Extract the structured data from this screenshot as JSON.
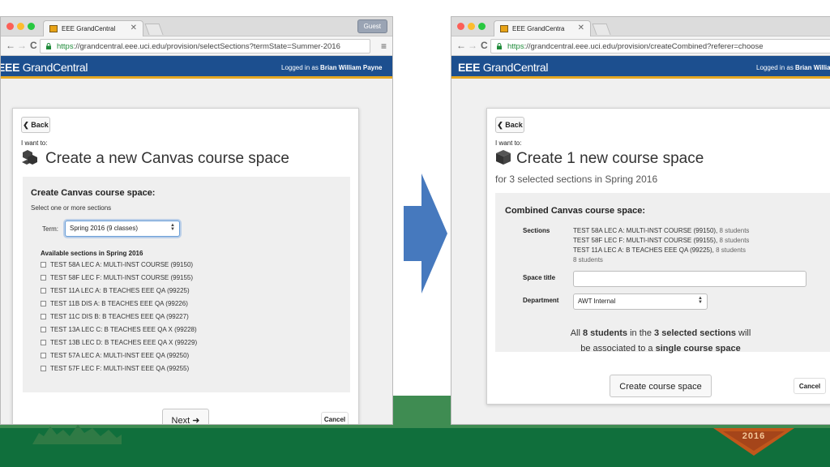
{
  "colors": {
    "app_bar": "#1c4f8f",
    "accent_stripe": "#e5a823",
    "green_light": "#3f8c52",
    "green_dark": "#106f3c",
    "arrow": "#4679be"
  },
  "background": {
    "banner_year": "2016"
  },
  "left": {
    "tab_title": "EEE GrandCentral",
    "tab_close": "✕",
    "guest_label": "Guest",
    "nav": {
      "back": "←",
      "forward": "→",
      "reload": "C"
    },
    "url_scheme": "https",
    "url_rest": "://grandcentral.eee.uci.edu/provision/selectSections?termState=Summer-2016",
    "menu_icon": "≡",
    "brand_bold": "EEE ",
    "brand_light": "GrandCentral",
    "login_prefix": "Logged in as ",
    "login_name": "Brian William Payne",
    "back_chevron": "❮",
    "back_label": "Back",
    "i_want_to": "I want to:",
    "heading": "Create a new Canvas course space",
    "panel_title": "Create Canvas course space:",
    "instruction": "Select one or more sections",
    "term_label": "Term:",
    "term_value": "Spring 2016 (9 classes)",
    "caret_up": "▲",
    "caret_down": "▼",
    "available_label": "Available sections in Spring 2016",
    "sections": [
      "TEST 58A LEC A: MULTI-INST COURSE (99150)",
      "TEST 58F LEC F: MULTI-INST COURSE (99155)",
      "TEST 11A LEC A: B TEACHES EEE QA (99225)",
      "TEST 11B DIS A: B TEACHES EEE QA (99226)",
      "TEST 11C DIS B: B TEACHES EEE QA (99227)",
      "TEST 13A LEC C: B TEACHES EEE QA X (99228)",
      "TEST 13B LEC D: B TEACHES EEE QA X (99229)",
      "TEST 57A LEC A: MULTI-INST EEE QA (99250)",
      "TEST 57F LEC F: MULTI-INST EEE QA (99255)"
    ],
    "next_label": "Next ",
    "next_icon": "➜",
    "cancel_label": "Cancel"
  },
  "right": {
    "tab_title": "EEE GrandCentra",
    "tab_close": "✕",
    "nav": {
      "back": "←",
      "forward": "→",
      "reload": "C"
    },
    "url_scheme": "https",
    "url_rest": "://grandcentral.eee.uci.edu/provision/createCombined?referer=choose",
    "brand_bold": "EEE ",
    "brand_light": "GrandCentral",
    "login_prefix": "Logged in as ",
    "login_name": "Brian William",
    "back_chevron": "❮",
    "back_label": "Back",
    "i_want_to": "I want to:",
    "heading": "Create 1 new course space",
    "subheading": "for 3 selected sections in Spring 2016",
    "panel_title": "Combined Canvas course space:",
    "sections_label": "Sections",
    "combined_sections": [
      {
        "name": "TEST 58A LEC A: MULTI-INST COURSE (99150), ",
        "students": "8 students"
      },
      {
        "name": "TEST 58F LEC F: MULTI-INST COURSE (99155), ",
        "students": "8 students"
      },
      {
        "name": "TEST 11A LEC A: B TEACHES EEE QA (99225), ",
        "students": "8 students"
      }
    ],
    "total_students": "8 students",
    "space_title_label": "Space title",
    "space_title_value": "",
    "department_label": "Department",
    "department_value": "AWT Internal",
    "caret_up": "▲",
    "caret_down": "▼",
    "note": {
      "p1": "All ",
      "b1": "8 students",
      "p2": " in the ",
      "b2": "3 selected sections",
      "p3": " will",
      "p4": "be associated to a ",
      "b3": "single course space"
    },
    "create_label": "Create course space",
    "cancel_label": "Cancel"
  }
}
